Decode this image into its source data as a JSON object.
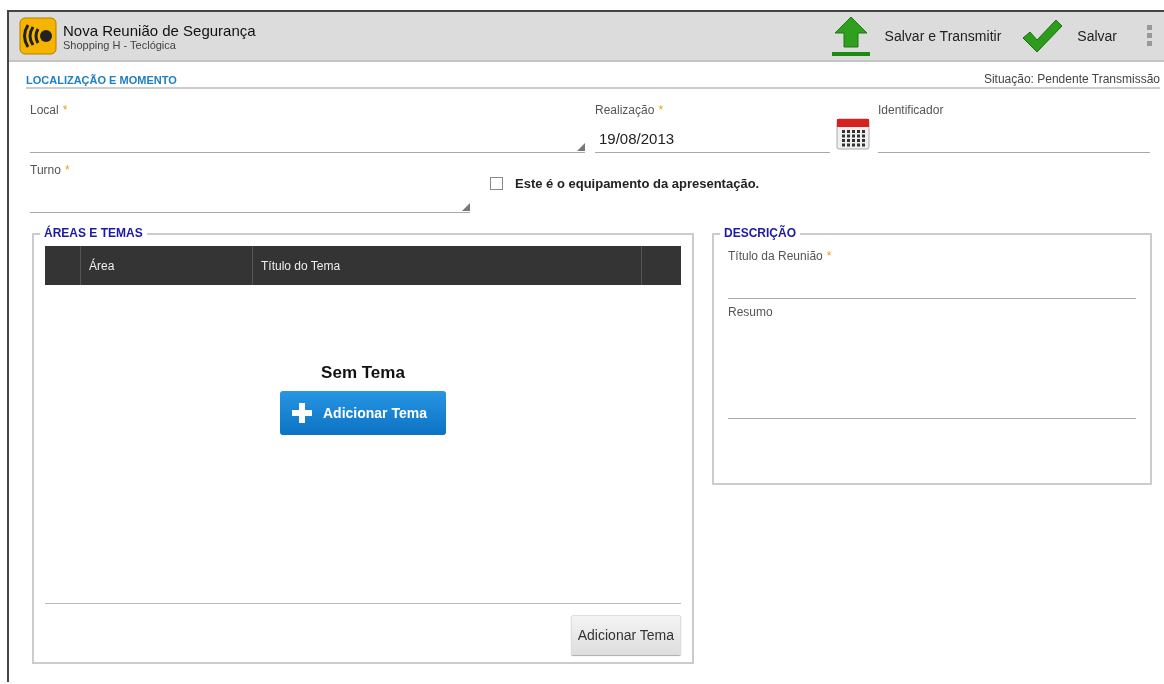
{
  "header": {
    "title": "Nova Reunião de Segurança",
    "subtitle": "Shopping H - Teclógica",
    "actions": [
      {
        "kind": "upload",
        "label": "Salvar e Transmitir"
      },
      {
        "kind": "save",
        "label": "Salvar"
      }
    ]
  },
  "section": {
    "title": "LOCALIZAÇÃO E MOMENTO",
    "status": "Situação: Pendente Transmissão"
  },
  "fields": [
    {
      "kind": "dropdown",
      "label": "Local",
      "required_mark": "*"
    },
    {
      "kind": "date",
      "label": "Realização",
      "required_mark": "*",
      "value": "19/08/2013"
    },
    {
      "kind": "text",
      "label": "Identificador"
    },
    {
      "kind": "dropdown",
      "label": "Turno",
      "required_mark": "*"
    }
  ],
  "checkbox": {
    "label": "Este é o equipamento da apresentação.",
    "checked": false
  },
  "areas": {
    "title": "ÁREAS E TEMAS",
    "columns": [
      "Área",
      "Título do Tema"
    ],
    "empty_text": "Sem Tema",
    "add_button": "Adicionar Tema",
    "footer_button": "Adicionar Tema"
  },
  "description": {
    "title": "DESCRIÇÃO",
    "fields": [
      {
        "kind": "text",
        "label": "Título da Reunião",
        "required_mark": "*"
      },
      {
        "kind": "textarea",
        "label": "Resumo"
      }
    ]
  }
}
